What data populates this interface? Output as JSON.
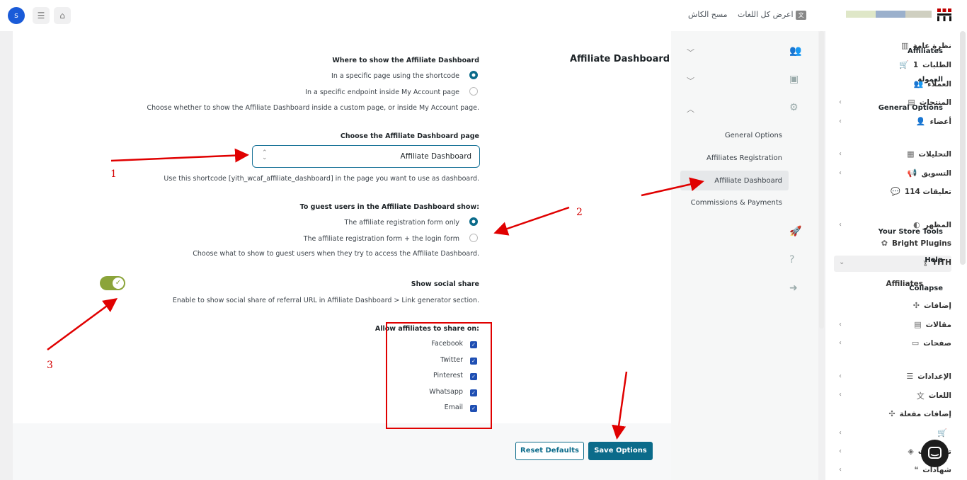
{
  "topbar": {
    "clear_cache": "مسح الكاش",
    "show_all_languages": "اعرض كل اللغات",
    "avatar_initial": "s",
    "brand_colors": [
      "#dfe7c8",
      "#9bb0cc",
      "#cfcfc0",
      "#c00000"
    ]
  },
  "admin_menu": {
    "items": [
      {
        "label": "نظرة عامة",
        "icon": "chart-icon"
      },
      {
        "label": "الطلبات",
        "badge": "1",
        "icon": "cart-icon"
      },
      {
        "label": "العملاء",
        "icon": "users-icon"
      },
      {
        "label": "المنتجات",
        "icon": "archive-icon"
      },
      {
        "label": "أعضاء",
        "icon": "member-icon"
      },
      {
        "label": "التحليلات",
        "icon": "analytics-icon"
      },
      {
        "label": "التسويق",
        "icon": "megaphone-icon"
      },
      {
        "label": "تعليقات 114",
        "icon": "comment-icon"
      },
      {
        "label": "المظهر",
        "icon": "palette-icon"
      },
      {
        "label": "Bright Plugins",
        "icon": "plugin-icon"
      },
      {
        "label": "YITH",
        "icon": "yith-icon"
      },
      {
        "label": "Affiliates",
        "icon": ""
      },
      {
        "label": "إضافات",
        "icon": "puzzle-icon"
      },
      {
        "label": "مقالات",
        "icon": "posts-icon"
      },
      {
        "label": "صفحات",
        "icon": "pages-icon"
      },
      {
        "label": "الإعدادات",
        "icon": "settings-icon"
      },
      {
        "label": "اللغات",
        "icon": "language-icon"
      },
      {
        "label": "إضافات مفعلة",
        "icon": "puzzle-icon"
      },
      {
        "label": "",
        "icon": "cart-icon"
      },
      {
        "label": "تصميمات",
        "icon": "design-icon"
      },
      {
        "label": "شهادات",
        "icon": "testimonial-icon"
      }
    ]
  },
  "plugin_nav": {
    "items": [
      {
        "label": "Affiliates",
        "icon": "people-icon"
      },
      {
        "label": "العمولة",
        "icon": "money-icon"
      },
      {
        "label": "General Options",
        "icon": "gear-icon"
      }
    ],
    "subitems": [
      "General Options",
      "Affiliates Registration",
      "Affiliate Dashboard",
      "Commissions & Payments"
    ],
    "extra": [
      {
        "label": "Your Store Tools",
        "icon": "rocket-icon"
      },
      {
        "label": "Help",
        "icon": "help-icon"
      },
      {
        "label": "Collapse",
        "icon": "collapse-icon"
      }
    ]
  },
  "main": {
    "title": "Affiliate Dashboard",
    "where_to_show": {
      "label": "Where to show the Affiliate Dashboard",
      "options": [
        "In a specific page using the shortcode",
        "In a specific endpoint inside My Account page"
      ],
      "selected": 0,
      "help": "Choose whether to show the Affiliate Dashboard inside a custom page, or inside My Account page."
    },
    "dashboard_page": {
      "label": "Choose the Affiliate Dashboard page",
      "value": "Affiliate Dashboard",
      "help": "Use this shortcode [yith_wcaf_affiliate_dashboard] in the page you want to use as dashboard."
    },
    "guest_show": {
      "label": "To guest users in the Affiliate Dashboard show:",
      "options": [
        "The affiliate registration form only",
        "The affiliate registration form + the login form"
      ],
      "selected": 0,
      "help": "Choose what to show to guest users when they try to access the Affiliate Dashboard."
    },
    "social_share": {
      "label": "Show social share",
      "enabled": true,
      "help": "Enable to show social share of referral URL in Affiliate Dashboard > Link generator section."
    },
    "share_on": {
      "label": "Allow affiliates to share on:",
      "networks": [
        "Facebook",
        "Twitter",
        "Pinterest",
        "Whatsapp",
        "Email"
      ]
    }
  },
  "footer": {
    "reset": "Reset Defaults",
    "save": "Save Options"
  },
  "annotations": [
    "1",
    "2",
    "3"
  ]
}
